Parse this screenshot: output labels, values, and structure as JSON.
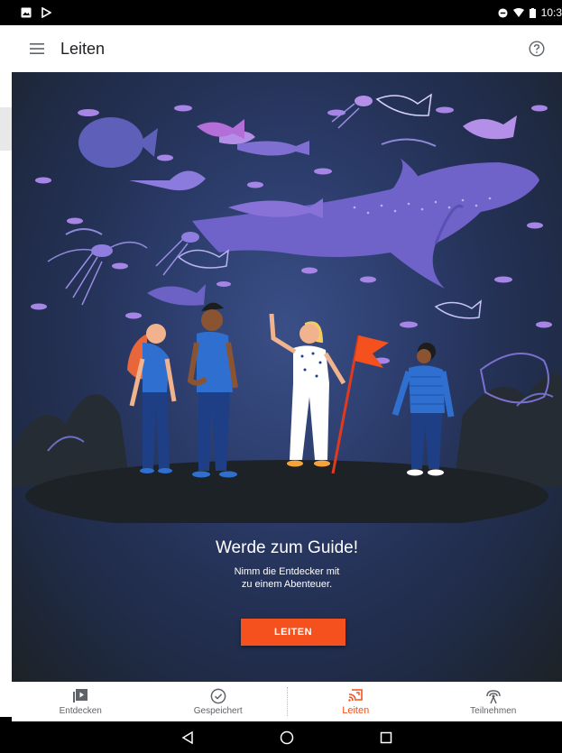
{
  "status": {
    "time": "10:3"
  },
  "appbar": {
    "title": "Leiten"
  },
  "hero": {
    "title": "Werde zum Guide!",
    "subtitle_line1": "Nimm die Entdecker mit",
    "subtitle_line2": "zu einem Abenteuer.",
    "button_label": "LEITEN"
  },
  "nav": [
    {
      "label": "Entdecken",
      "icon": "play-library-icon"
    },
    {
      "label": "Gespeichert",
      "icon": "check-circle-icon"
    },
    {
      "label": "Leiten",
      "icon": "cast-lead-icon",
      "active": true
    },
    {
      "label": "Teilnehmen",
      "icon": "broadcast-icon"
    }
  ],
  "colors": {
    "accent": "#f4511e",
    "background": "#1d2226",
    "bar": "#ffffff"
  }
}
